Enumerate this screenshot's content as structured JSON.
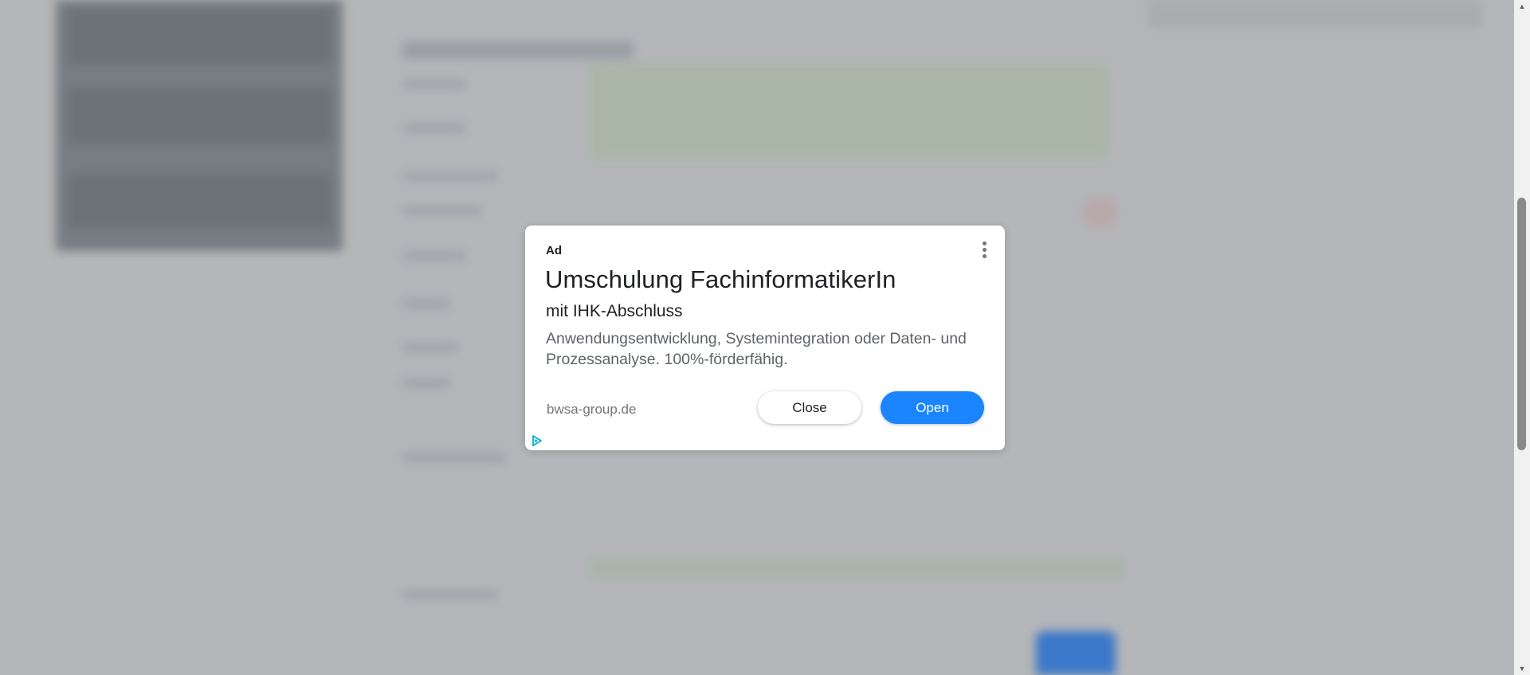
{
  "ad": {
    "label": "Ad",
    "headline": "Umschulung FachinformatikerIn",
    "subheadline": "mit IHK-Abschluss",
    "description": "Anwendungsentwicklung, Systemintegration oder Daten- und Prozessanalyse. 100%-förderfähig.",
    "domain": "bwsa-group.de",
    "close_label": "Close",
    "open_label": "Open",
    "menu_icon": "more-vert-icon",
    "adchoices_icon": "adchoices-icon",
    "accent_color": "#1a85ff"
  },
  "scrollbar": {
    "up_icon": "scroll-up-arrow-icon",
    "down_icon": "scroll-down-arrow-icon"
  }
}
